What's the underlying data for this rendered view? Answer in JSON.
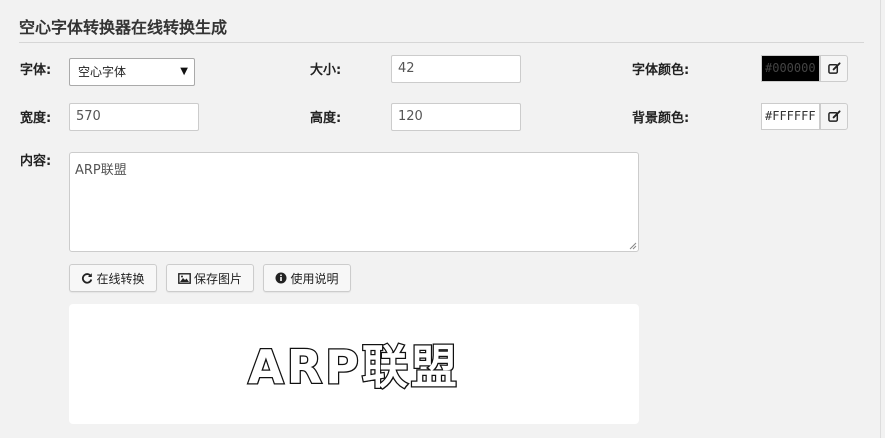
{
  "page_title": "空心字体转换器在线转换生成",
  "labels": {
    "font": "字体:",
    "size": "大小:",
    "font_color": "字体颜色:",
    "width": "宽度:",
    "height": "高度:",
    "bg_color": "背景颜色:",
    "content": "内容:"
  },
  "fields": {
    "font_select": "空心字体",
    "size": "42",
    "font_color": "#000000",
    "width": "570",
    "height": "120",
    "bg_color": "#FFFFFF",
    "content": "ARP联盟"
  },
  "colors": {
    "font_color_swatch": "#000000",
    "font_color_text": "#444444",
    "bg_color_swatch": "#FFFFFF"
  },
  "buttons": {
    "convert": "在线转换",
    "save_image": "保存图片",
    "usage": "使用说明"
  },
  "icons": {
    "convert": "refresh-icon",
    "save_image": "image-icon",
    "usage": "info-icon",
    "font_color_picker": "edit-icon",
    "bg_color_picker": "edit-icon"
  },
  "preview": {
    "text": "ARP联盟"
  }
}
